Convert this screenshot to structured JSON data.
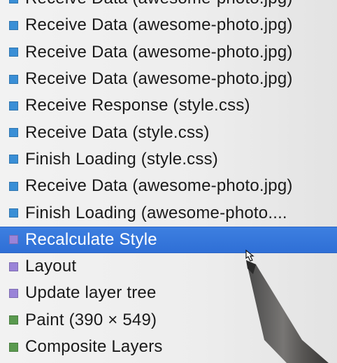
{
  "event_list": {
    "items": [
      {
        "label": "Receive Data (awesome-photo.jpg)",
        "color": "#3a8fd6",
        "category": "loading"
      },
      {
        "label": "Receive Data (awesome-photo.jpg)",
        "color": "#3a8fd6",
        "category": "loading"
      },
      {
        "label": "Receive Data (awesome-photo.jpg)",
        "color": "#3a8fd6",
        "category": "loading"
      },
      {
        "label": "Receive Data (awesome-photo.jpg)",
        "color": "#3a8fd6",
        "category": "loading"
      },
      {
        "label": "Receive Response (style.css)",
        "color": "#3a8fd6",
        "category": "loading"
      },
      {
        "label": "Receive Data (style.css)",
        "color": "#3a8fd6",
        "category": "loading"
      },
      {
        "label": "Finish Loading (style.css)",
        "color": "#3a8fd6",
        "category": "loading"
      },
      {
        "label": "Receive Data (awesome-photo.jpg)",
        "color": "#3a8fd6",
        "category": "loading"
      },
      {
        "label": "Finish Loading (awesome-photo....",
        "color": "#3a8fd6",
        "category": "loading"
      },
      {
        "label": "Recalculate Style",
        "color": "#9a84d8",
        "category": "rendering",
        "selected": true
      },
      {
        "label": "Layout",
        "color": "#9a84d8",
        "category": "rendering"
      },
      {
        "label": "Update layer tree",
        "color": "#9a84d8",
        "category": "rendering"
      },
      {
        "label": "Paint (390 × 549)",
        "color": "#5a9a4f",
        "category": "painting"
      },
      {
        "label": "Composite Layers",
        "color": "#5a9a4f",
        "category": "painting"
      }
    ]
  },
  "colors": {
    "selection": "#2f6fd6",
    "loading": "#3a8fd6",
    "rendering": "#9a84d8",
    "painting": "#5a9a4f"
  },
  "overlay": {
    "icon": "stylus-pointer-icon"
  }
}
